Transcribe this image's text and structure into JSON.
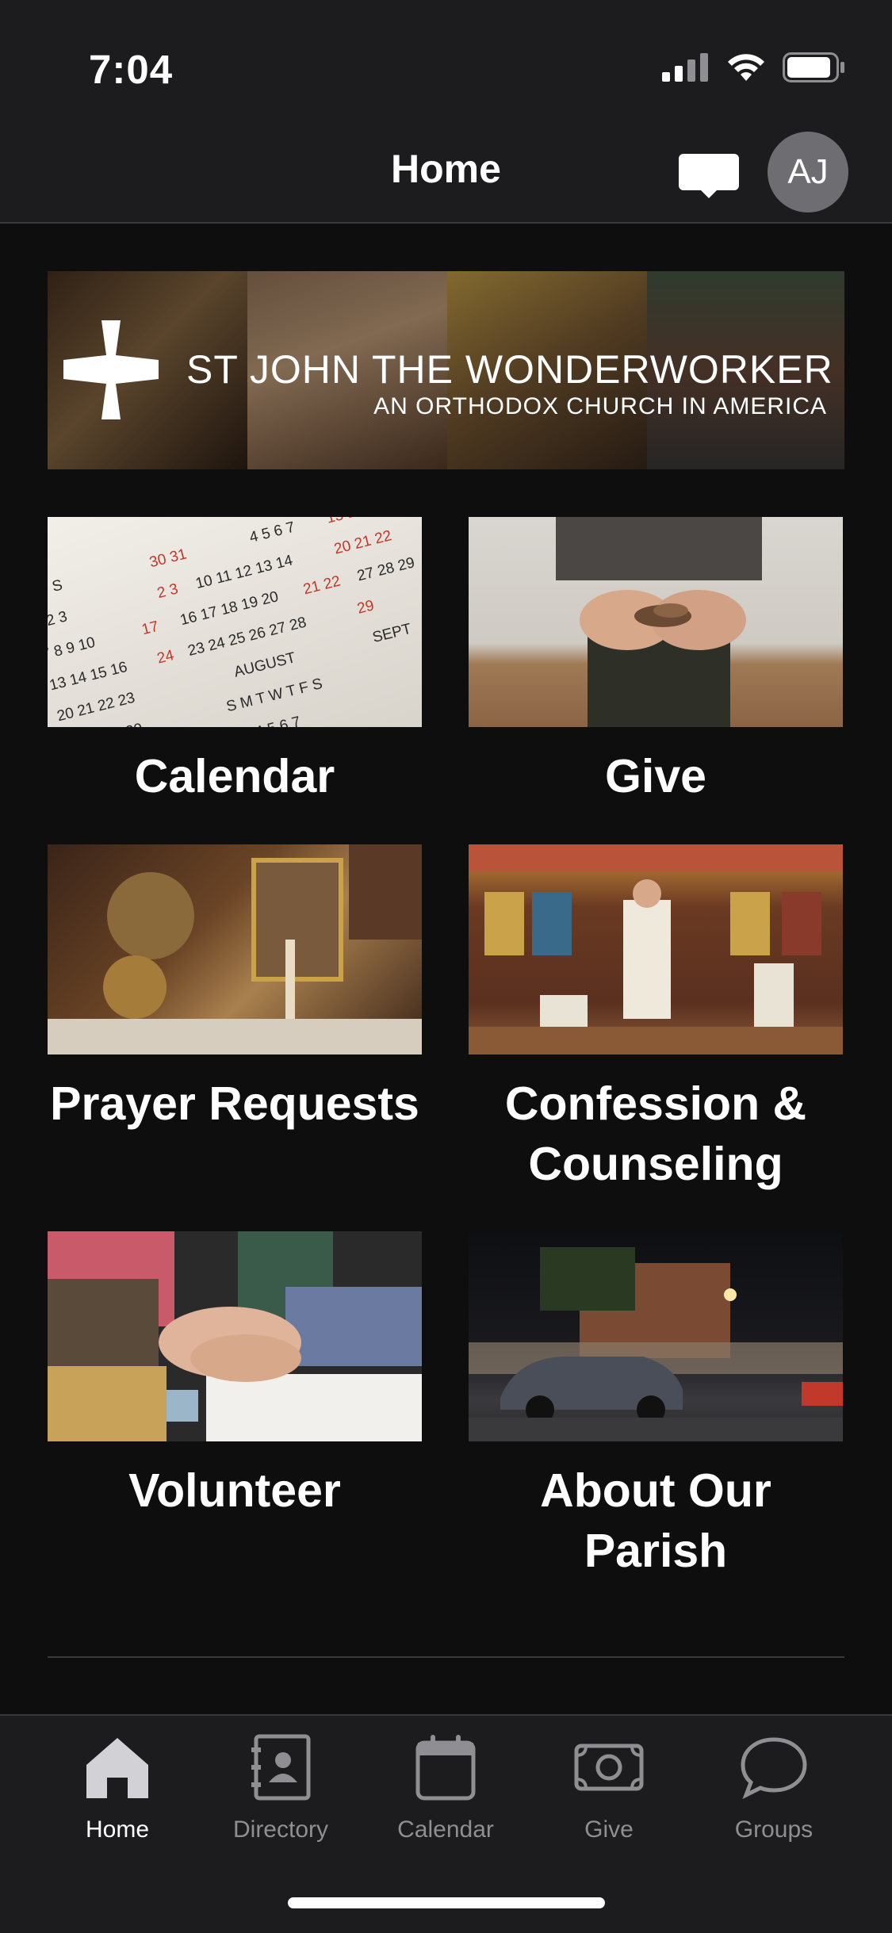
{
  "status_bar": {
    "time": "7:04",
    "icons": [
      "signal-icon",
      "wifi-icon",
      "battery-icon"
    ]
  },
  "header": {
    "title": "Home",
    "chat_icon": "chat-bubble-icon",
    "avatar_initials": "AJ"
  },
  "banner": {
    "title": "ST JOHN THE WONDERWORKER",
    "subtitle": "AN ORTHODOX CHURCH IN AMERICA",
    "icon": "orthodox-cross-icon"
  },
  "tiles": [
    {
      "label": "Calendar"
    },
    {
      "label": "Give"
    },
    {
      "label": "Prayer Requests"
    },
    {
      "label": "Confession & Counseling"
    },
    {
      "label": "Volunteer"
    },
    {
      "label": "About Our Parish"
    }
  ],
  "tab_bar": {
    "items": [
      {
        "label": "Home",
        "icon": "home-icon",
        "active": true
      },
      {
        "label": "Directory",
        "icon": "contact-book-icon",
        "active": false
      },
      {
        "label": "Calendar",
        "icon": "calendar-icon",
        "active": false
      },
      {
        "label": "Give",
        "icon": "money-icon",
        "active": false
      },
      {
        "label": "Groups",
        "icon": "chat-icon",
        "active": false
      }
    ]
  },
  "colors": {
    "background": "#0e0e0e",
    "bar_background": "#1c1c1e",
    "inactive_tab": "#8e8e93",
    "text": "#ffffff"
  }
}
